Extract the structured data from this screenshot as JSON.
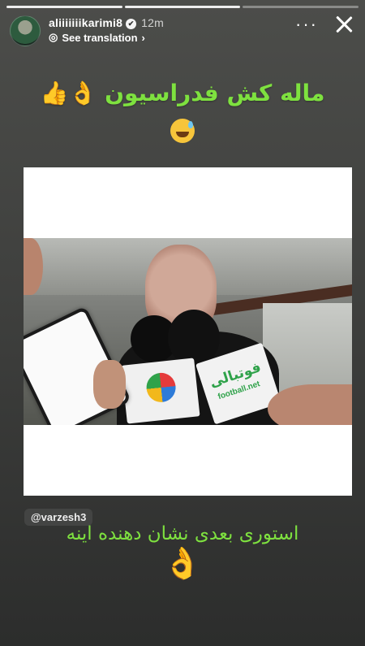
{
  "story": {
    "progress_segments": 3,
    "progress_active_index": 1
  },
  "header": {
    "username": "aliiiiiiikarimi8",
    "verified": true,
    "time_ago": "12m",
    "translation_label": "See translation",
    "more_icon": "more-icon",
    "close_icon": "close-icon"
  },
  "content": {
    "headline_text": "ماله کش فدراسیون",
    "headline_emoji": "👌👍",
    "emoji_under_headline": "😅",
    "video_logos": {
      "footballi_arabic": "فوتبالی",
      "footballi_latin": "football.net"
    },
    "mention": "@varzesh3",
    "caption": "استوری بعدی نشان دهنده اینه",
    "caption_emoji": "👌"
  },
  "colors": {
    "accent_green": "#7ee13f",
    "background_top": "#4c4d4a",
    "background_bottom": "#2c2d2c"
  }
}
